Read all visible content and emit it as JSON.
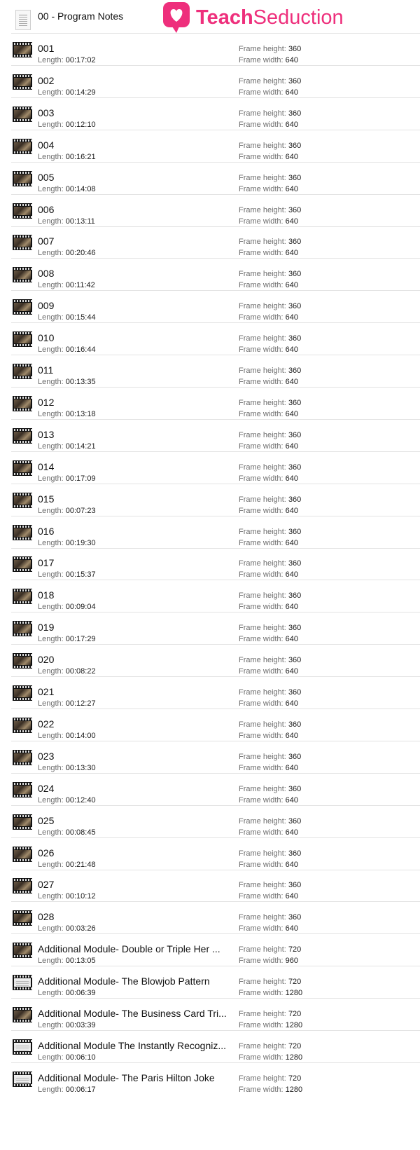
{
  "brand": {
    "part1": "Teach",
    "part2": "Seduction",
    "accent": "#ee2f7c"
  },
  "labels": {
    "length": "Length:",
    "frame_height": "Frame height:",
    "frame_width": "Frame width:"
  },
  "header_item": {
    "name": "00 - Program Notes",
    "icon": "document-icon"
  },
  "files": [
    {
      "name": "001",
      "length": "00:17:02",
      "frame_height": "360",
      "frame_width": "640"
    },
    {
      "name": "002",
      "length": "00:14:29",
      "frame_height": "360",
      "frame_width": "640"
    },
    {
      "name": "003",
      "length": "00:12:10",
      "frame_height": "360",
      "frame_width": "640"
    },
    {
      "name": "004",
      "length": "00:16:21",
      "frame_height": "360",
      "frame_width": "640"
    },
    {
      "name": "005",
      "length": "00:14:08",
      "frame_height": "360",
      "frame_width": "640"
    },
    {
      "name": "006",
      "length": "00:13:11",
      "frame_height": "360",
      "frame_width": "640"
    },
    {
      "name": "007",
      "length": "00:20:46",
      "frame_height": "360",
      "frame_width": "640"
    },
    {
      "name": "008",
      "length": "00:11:42",
      "frame_height": "360",
      "frame_width": "640"
    },
    {
      "name": "009",
      "length": "00:15:44",
      "frame_height": "360",
      "frame_width": "640"
    },
    {
      "name": "010",
      "length": "00:16:44",
      "frame_height": "360",
      "frame_width": "640"
    },
    {
      "name": "011",
      "length": "00:13:35",
      "frame_height": "360",
      "frame_width": "640"
    },
    {
      "name": "012",
      "length": "00:13:18",
      "frame_height": "360",
      "frame_width": "640"
    },
    {
      "name": "013",
      "length": "00:14:21",
      "frame_height": "360",
      "frame_width": "640"
    },
    {
      "name": "014",
      "length": "00:17:09",
      "frame_height": "360",
      "frame_width": "640"
    },
    {
      "name": "015",
      "length": "00:07:23",
      "frame_height": "360",
      "frame_width": "640"
    },
    {
      "name": "016",
      "length": "00:19:30",
      "frame_height": "360",
      "frame_width": "640"
    },
    {
      "name": "017",
      "length": "00:15:37",
      "frame_height": "360",
      "frame_width": "640"
    },
    {
      "name": "018",
      "length": "00:09:04",
      "frame_height": "360",
      "frame_width": "640"
    },
    {
      "name": "019",
      "length": "00:17:29",
      "frame_height": "360",
      "frame_width": "640"
    },
    {
      "name": "020",
      "length": "00:08:22",
      "frame_height": "360",
      "frame_width": "640"
    },
    {
      "name": "021",
      "length": "00:12:27",
      "frame_height": "360",
      "frame_width": "640"
    },
    {
      "name": "022",
      "length": "00:14:00",
      "frame_height": "360",
      "frame_width": "640"
    },
    {
      "name": "023",
      "length": "00:13:30",
      "frame_height": "360",
      "frame_width": "640"
    },
    {
      "name": "024",
      "length": "00:12:40",
      "frame_height": "360",
      "frame_width": "640"
    },
    {
      "name": "025",
      "length": "00:08:45",
      "frame_height": "360",
      "frame_width": "640"
    },
    {
      "name": "026",
      "length": "00:21:48",
      "frame_height": "360",
      "frame_width": "640"
    },
    {
      "name": "027",
      "length": "00:10:12",
      "frame_height": "360",
      "frame_width": "640"
    },
    {
      "name": "028",
      "length": "00:03:26",
      "frame_height": "360",
      "frame_width": "640"
    },
    {
      "name": "Additional Module- Double or Triple Her ...",
      "length": "00:13:05",
      "frame_height": "720",
      "frame_width": "960"
    },
    {
      "name": "Additional Module- The Blowjob Pattern",
      "length": "00:06:39",
      "frame_height": "720",
      "frame_width": "1280",
      "thumb_style": "light"
    },
    {
      "name": "Additional Module- The Business Card Tri...",
      "length": "00:03:39",
      "frame_height": "720",
      "frame_width": "1280"
    },
    {
      "name": "Additional Module The Instantly Recogniz...",
      "length": "00:06:10",
      "frame_height": "720",
      "frame_width": "1280",
      "thumb_style": "light"
    },
    {
      "name": "Additional Module- The Paris Hilton Joke",
      "length": "00:06:17",
      "frame_height": "720",
      "frame_width": "1280",
      "thumb_style": "light"
    }
  ]
}
